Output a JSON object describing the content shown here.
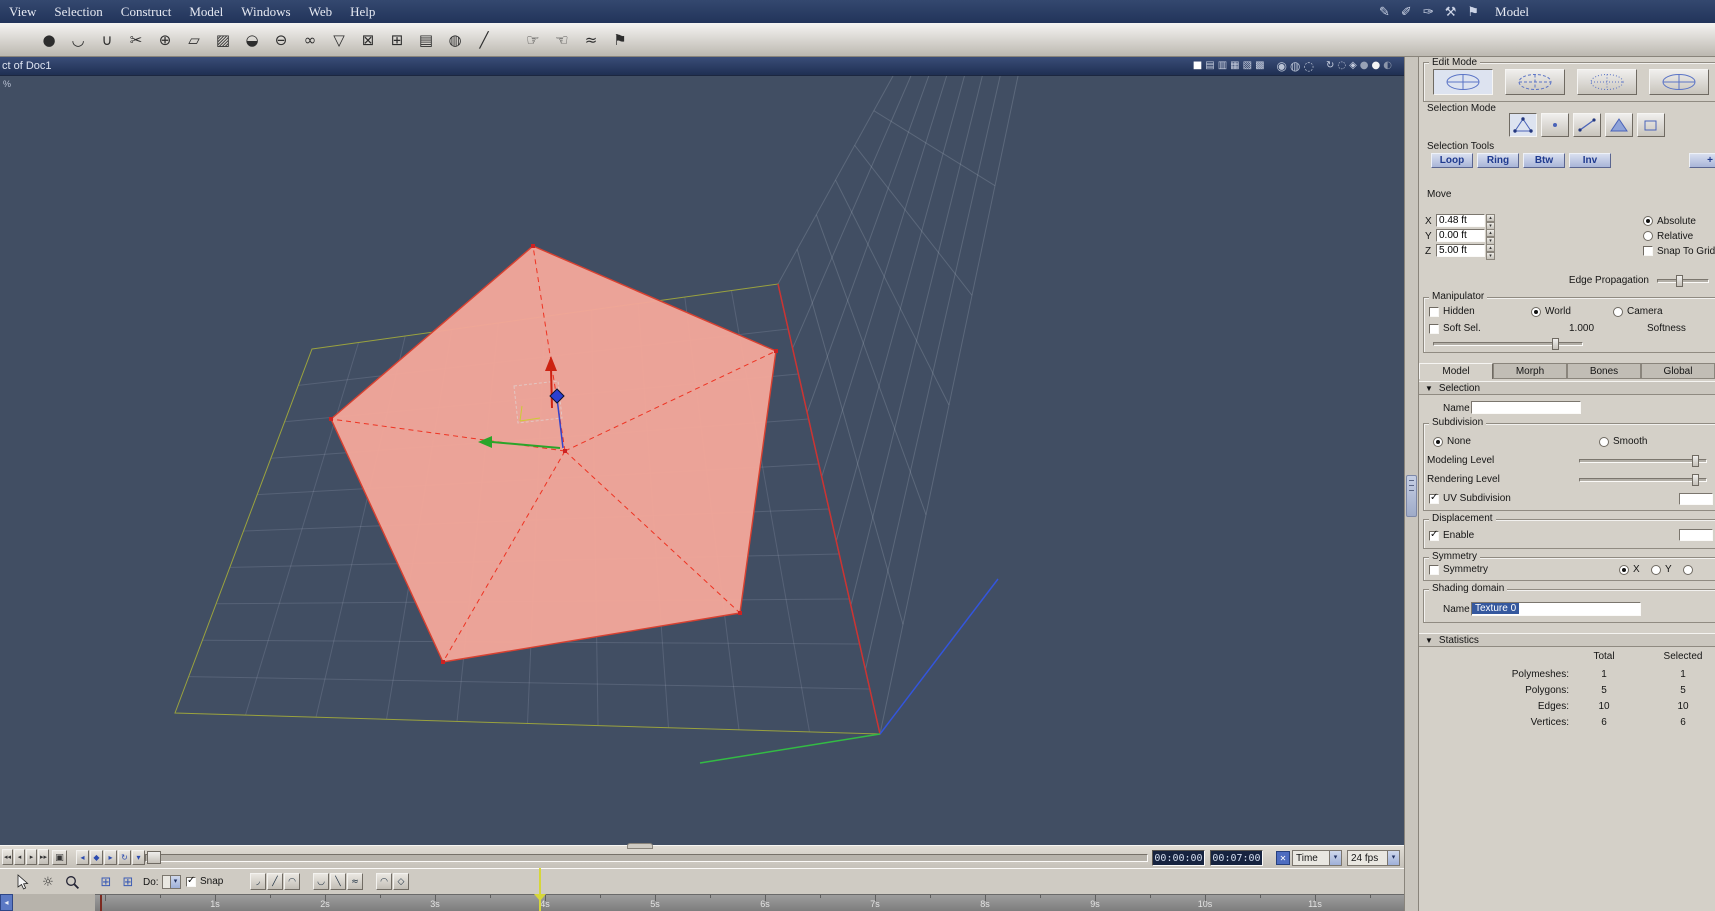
{
  "app": {
    "right_menu_label": "Model"
  },
  "menu": {
    "items": [
      "View",
      "Selection",
      "Construct",
      "Model",
      "Windows",
      "Web",
      "Help"
    ],
    "right_icons": [
      {
        "name": "pen-icon",
        "glyph": "✎"
      },
      {
        "name": "pencil-icon",
        "glyph": "✐"
      },
      {
        "name": "knife-icon",
        "glyph": "✑"
      },
      {
        "name": "hammer-icon",
        "glyph": "⚒"
      },
      {
        "name": "flag-icon",
        "glyph": "⚑"
      }
    ]
  },
  "toolbar": {
    "icons": [
      {
        "name": "sphere-primitive-icon",
        "glyph": "●"
      },
      {
        "name": "curve-tool-icon",
        "glyph": "◡"
      },
      {
        "name": "magnet-tool-icon",
        "glyph": "∪"
      },
      {
        "name": "scissors-tool-icon",
        "glyph": "✂"
      },
      {
        "name": "weld-tool-icon",
        "glyph": "⊕"
      },
      {
        "name": "marquee-tool-icon",
        "glyph": "▱"
      },
      {
        "name": "polygon-tool-icon",
        "glyph": "▨"
      },
      {
        "name": "dome-tool-icon",
        "glyph": "◒"
      },
      {
        "name": "cylinder-tool-icon",
        "glyph": "⊖"
      },
      {
        "name": "link-tool-icon",
        "glyph": "∞"
      },
      {
        "name": "funnel-tool-icon",
        "glyph": "▽"
      },
      {
        "name": "delete-tool-icon",
        "glyph": "⊠"
      },
      {
        "name": "cube-tool-icon",
        "glyph": "⊞"
      },
      {
        "name": "stack-tool-icon",
        "glyph": "▤"
      },
      {
        "name": "uv-sphere-tool-icon",
        "glyph": "◍"
      },
      {
        "name": "line-tool-icon",
        "glyph": "╱"
      },
      {
        "name": "push-hand-tool-icon",
        "glyph": "☞",
        "group2": true
      },
      {
        "name": "pull-hand-tool-icon",
        "glyph": "☜"
      },
      {
        "name": "smooth-tool-icon",
        "glyph": "≈"
      },
      {
        "name": "flag-tool-icon",
        "glyph": "⚑"
      }
    ]
  },
  "viewport": {
    "title": "ct of Doc1",
    "percent": "%",
    "layout_icons": [
      {
        "name": "layout-single-icon",
        "glyph": "■"
      },
      {
        "name": "layout-two-rows-icon",
        "glyph": "▤"
      },
      {
        "name": "layout-two-cols-icon",
        "glyph": "▥"
      },
      {
        "name": "layout-three-pane-icon",
        "glyph": "▦"
      },
      {
        "name": "layout-four-pane-icon",
        "glyph": "▧"
      },
      {
        "name": "layout-grid-icon",
        "glyph": "▩"
      }
    ],
    "shading_icons": [
      {
        "name": "shading-smooth-icon",
        "glyph": "◉"
      },
      {
        "name": "shading-flat-icon",
        "glyph": "◍"
      },
      {
        "name": "shading-wireframe-icon",
        "glyph": "◌"
      }
    ],
    "view_icons": [
      {
        "name": "orbit-view-icon",
        "glyph": "↻"
      },
      {
        "name": "target-view-icon",
        "glyph": "◌"
      },
      {
        "name": "perspective-view-icon",
        "glyph": "◈"
      },
      {
        "name": "light-sphere-gray-icon",
        "glyph": "●",
        "cls": "sph-gray"
      },
      {
        "name": "light-sphere-white-icon",
        "glyph": "●",
        "cls": "sph-white"
      },
      {
        "name": "light-sphere-dark-icon",
        "glyph": "◐",
        "cls": "sph-dark"
      }
    ]
  },
  "panel": {
    "edit_mode": {
      "label": "Edit Mode",
      "buttons": [
        {
          "name": "edit-mode-object-button",
          "active": true
        },
        {
          "name": "edit-mode-vertex-button",
          "active": false
        },
        {
          "name": "edit-mode-uv-button",
          "active": false
        },
        {
          "name": "edit-mode-assembly-button",
          "active": false
        }
      ]
    },
    "selection_mode": {
      "label": "Selection Mode",
      "buttons": [
        {
          "name": "select-points-button",
          "active": true
        },
        {
          "name": "select-vertices-button",
          "active": false
        },
        {
          "name": "select-edges-button",
          "active": false
        },
        {
          "name": "select-faces-button",
          "active": false
        },
        {
          "name": "select-objects-button",
          "active": false
        }
      ]
    },
    "selection_tools": {
      "label": "Selection Tools",
      "buttons": [
        "Loop",
        "Ring",
        "Btw",
        "Inv",
        "+"
      ]
    },
    "move": {
      "label": "Move",
      "rows": [
        {
          "axis": "X",
          "value": "0.48 ft"
        },
        {
          "axis": "Y",
          "value": "0.00 ft"
        },
        {
          "axis": "Z",
          "value": "5.00 ft"
        }
      ],
      "absolute_label": "Absolute",
      "relative_label": "Relative",
      "snap_label": "Snap To Grid",
      "edge_propagation_label": "Edge Propagation"
    },
    "manipulator": {
      "label": "Manipulator",
      "hidden_label": "Hidden",
      "world_label": "World",
      "camera_label": "Camera",
      "soft_label": "Soft Sel.",
      "soft_value": "1.000",
      "softness_label": "Softness"
    },
    "tabs": [
      "Model",
      "Morph",
      "Bones",
      "Global"
    ],
    "selection": {
      "label": "Selection",
      "name_label": "Name",
      "name_value": ""
    },
    "subdivision": {
      "label": "Subdivision",
      "none_label": "None",
      "smooth_label": "Smooth",
      "modeling_label": "Modeling Level",
      "rendering_label": "Rendering Level",
      "uv_label": "UV Subdivision"
    },
    "displacement": {
      "label": "Displacement",
      "enable_label": "Enable"
    },
    "symmetry": {
      "label": "Symmetry",
      "symmetry_label": "Symmetry",
      "x_label": "X",
      "y_label": "Y"
    },
    "shading_domain": {
      "label": "Shading domain",
      "name_label": "Name",
      "value": "Texture 0"
    },
    "statistics": {
      "label": "Statistics",
      "total_header": "Total",
      "selected_header": "Selected",
      "rows": [
        {
          "label": "Polymeshes:",
          "total": "1",
          "selected": "1"
        },
        {
          "label": "Polygons:",
          "total": "5",
          "selected": "5"
        },
        {
          "label": "Edges:",
          "total": "10",
          "selected": "10"
        },
        {
          "label": "Vertices:",
          "total": "6",
          "selected": "6"
        }
      ]
    }
  },
  "timeline": {
    "transport": [
      {
        "name": "jump-start-button",
        "glyph": "◂◂"
      },
      {
        "name": "step-back-button",
        "glyph": "◂"
      },
      {
        "name": "step-forward-button",
        "glyph": "▸"
      },
      {
        "name": "jump-end-button",
        "glyph": "▸▸"
      }
    ],
    "range_button_glyph": "▣",
    "key_buttons": [
      {
        "name": "prev-keyframe-button",
        "glyph": "◂"
      },
      {
        "name": "add-keyframe-button",
        "glyph": "◆"
      },
      {
        "name": "next-keyframe-button",
        "glyph": "▸"
      },
      {
        "name": "loop-playback-button",
        "glyph": "↻"
      },
      {
        "name": "keyframe-options-button",
        "glyph": "▾"
      }
    ],
    "time_current": "00:00:00",
    "time_total": "00:07:00",
    "x_button_glyph": "✕",
    "time_mode": "Time",
    "fps": "24 fps",
    "do_label": "Do:",
    "snap_label": "Snap",
    "tangent_buttons": [
      {
        "name": "key-corner-button",
        "glyph": "◞"
      },
      {
        "name": "key-linear-button",
        "glyph": "╱"
      },
      {
        "name": "key-arc-button",
        "glyph": "◠"
      },
      {
        "name": "key-dip-button",
        "glyph": "◡"
      },
      {
        "name": "key-slope-button",
        "glyph": "╲"
      },
      {
        "name": "key-wave-button",
        "glyph": "≈"
      },
      {
        "name": "key-smooth-button",
        "glyph": "◠"
      },
      {
        "name": "key-diamond-button",
        "glyph": "◇"
      }
    ],
    "ruler_labels": [
      "1s",
      "2s",
      "3s",
      "4s",
      "5s",
      "6s",
      "7s",
      "8s",
      "9s",
      "10s",
      "11s"
    ]
  },
  "colors": {
    "accent_blue": "#35589e",
    "viewport_bg": "#414e63",
    "panel_bg": "#d4d0c8",
    "selection_fill": "#f2a79a",
    "selection_edge": "#d84030",
    "axis_red": "#cc3333",
    "axis_green": "#33bb44",
    "axis_blue": "#3355dd",
    "plane_outline": "#9aa23e",
    "playhead": "#d6d63a"
  }
}
